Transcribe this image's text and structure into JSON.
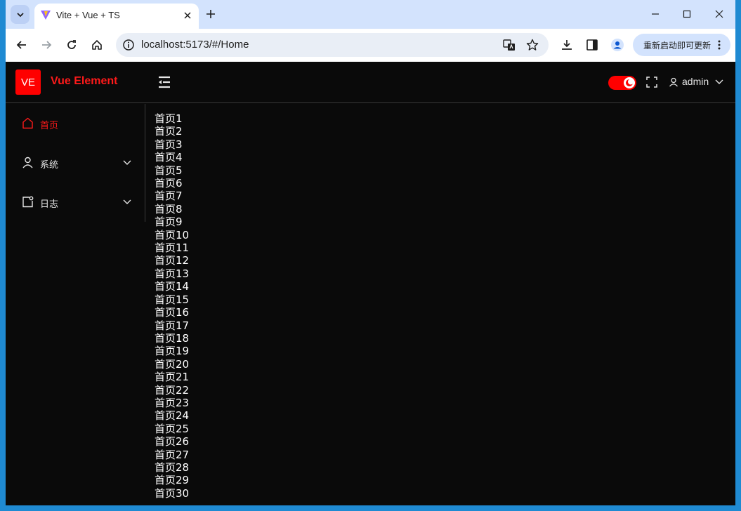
{
  "browser": {
    "tab_title": "Vite + Vue + TS",
    "url": "localhost:5173/#/Home",
    "update_label": "重新启动即可更新"
  },
  "app": {
    "logo_badge": "VE",
    "logo_text": "Vue Element",
    "user_name": "admin"
  },
  "sidebar": {
    "items": [
      {
        "label": "首页",
        "icon": "home-icon",
        "active": true,
        "expandable": false
      },
      {
        "label": "系统",
        "icon": "user-icon",
        "active": false,
        "expandable": true
      },
      {
        "label": "日志",
        "icon": "log-icon",
        "active": false,
        "expandable": true
      }
    ]
  },
  "content": {
    "lines": [
      "首页1",
      "首页2",
      "首页3",
      "首页4",
      "首页5",
      "首页6",
      "首页7",
      "首页8",
      "首页9",
      "首页10",
      "首页11",
      "首页12",
      "首页13",
      "首页14",
      "首页15",
      "首页16",
      "首页17",
      "首页18",
      "首页19",
      "首页20",
      "首页21",
      "首页22",
      "首页23",
      "首页24",
      "首页25",
      "首页26",
      "首页27",
      "首页28",
      "首页29",
      "首页30"
    ]
  },
  "colors": {
    "accent": "#ff0000",
    "background": "#0a0a0a",
    "chrome_tab_bar": "#d3e3fd"
  }
}
